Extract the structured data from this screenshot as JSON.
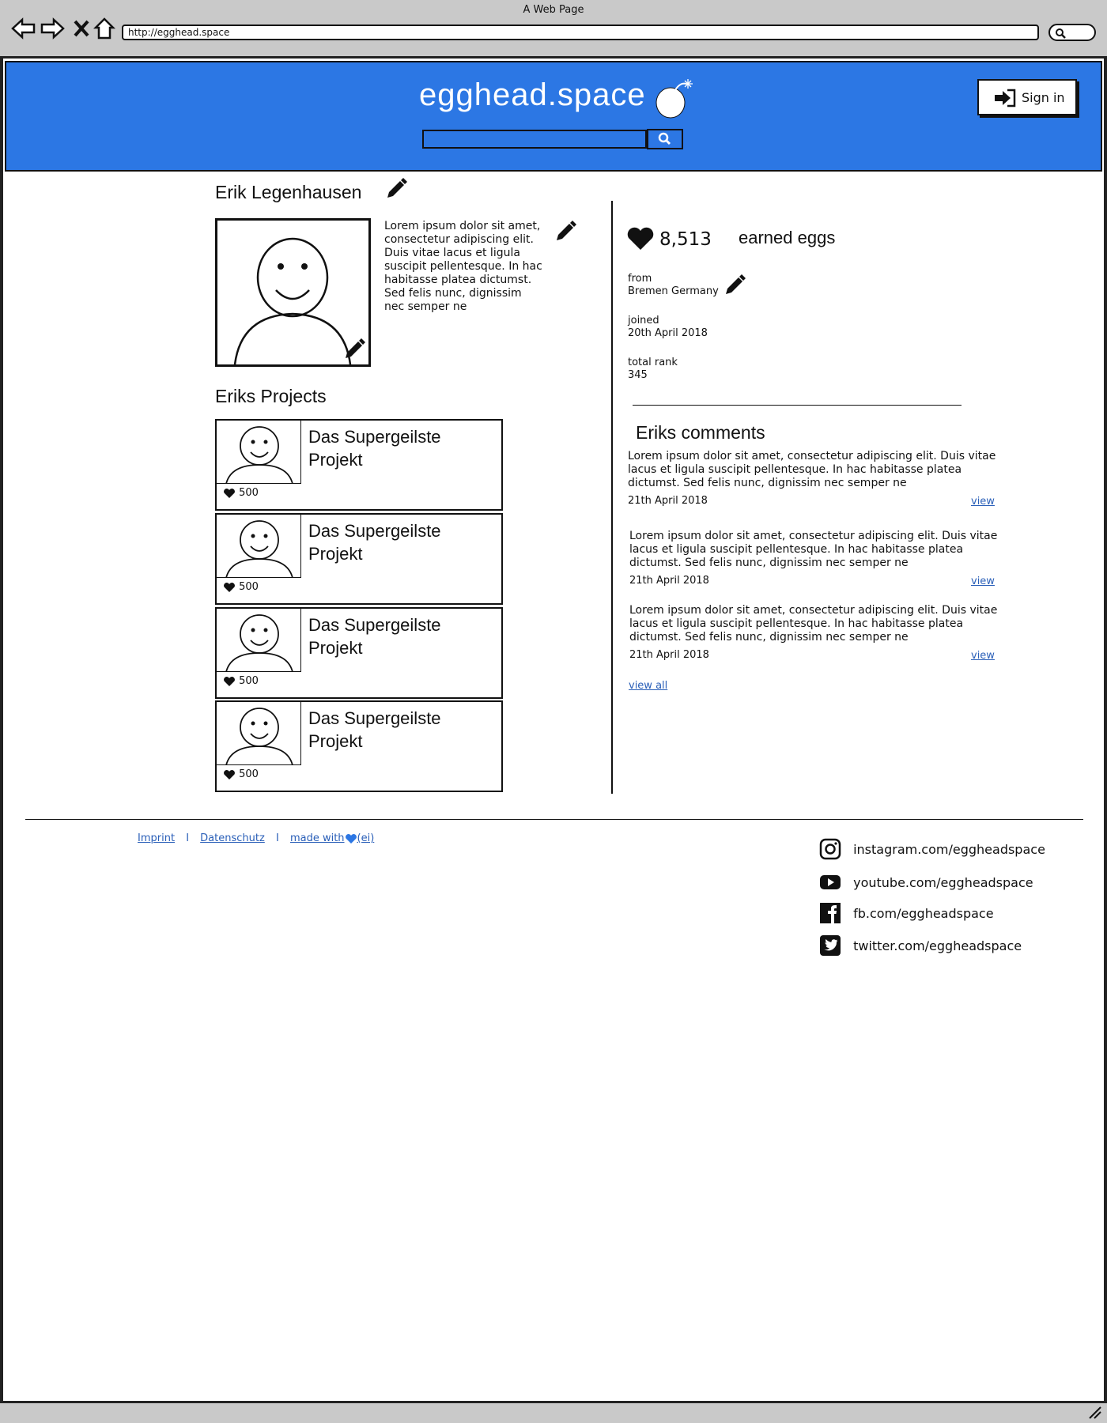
{
  "browser": {
    "window_title": "A Web Page",
    "url": "http://egghead.space"
  },
  "header": {
    "brand": "egghead.space",
    "search_placeholder": "",
    "sign_in_label": "Sign in",
    "accent_color": "#2c77e4"
  },
  "profile": {
    "name": "Erik Legenhausen",
    "bio": "Lorem ipsum dolor sit amet, consectetur adipiscing elit. Duis vitae lacus et ligula suscipit pellentesque. In hac habitasse platea dictumst. Sed felis nunc, dignissim nec semper ne",
    "eggs_count": "8,513",
    "eggs_label": "earned eggs",
    "from_label": "from",
    "from_value": "Bremen Germany",
    "joined_label": "joined",
    "joined_value": "20th April 2018",
    "rank_label": "total rank",
    "rank_value": "345"
  },
  "projects": {
    "heading": "Eriks  Projects",
    "items": [
      {
        "title": "Das Supergeilste Projekt",
        "likes": "500"
      },
      {
        "title": "Das Supergeilste Projekt",
        "likes": "500"
      },
      {
        "title": "Das Supergeilste Projekt",
        "likes": "500"
      },
      {
        "title": "Das Supergeilste Projekt",
        "likes": "500"
      }
    ]
  },
  "comments": {
    "heading": "Eriks comments",
    "items": [
      {
        "text": "Lorem ipsum dolor sit amet, consectetur adipiscing elit. Duis vitae lacus et ligula suscipit pellentesque. In hac habitasse platea dictumst. Sed felis nunc, dignissim nec semper ne",
        "date": "21th April 2018",
        "link": "view"
      },
      {
        "text": "Lorem ipsum dolor sit amet, consectetur adipiscing elit. Duis vitae lacus et ligula suscipit pellentesque. In hac habitasse platea dictumst. Sed felis nunc, dignissim nec semper ne",
        "date": "21th April 2018",
        "link": "view"
      },
      {
        "text": "Lorem ipsum dolor sit amet, consectetur adipiscing elit. Duis vitae lacus et ligula suscipit pellentesque. In hac habitasse platea dictumst. Sed felis nunc, dignissim nec semper ne",
        "date": "21th April 2018",
        "link": "view"
      }
    ],
    "view_all": "view all"
  },
  "footer": {
    "imprint": "Imprint",
    "sep": "I",
    "privacy": "Datenschutz",
    "made_with": "made with",
    "made_with_suffix": "(ei)",
    "social": [
      {
        "icon": "instagram-icon",
        "text": "instagram.com/eggheadspace"
      },
      {
        "icon": "youtube-icon",
        "text": "youtube.com/eggheadspace"
      },
      {
        "icon": "facebook-icon",
        "text": "fb.com/eggheadspace"
      },
      {
        "icon": "twitter-icon",
        "text": "twitter.com/eggheadspace"
      }
    ]
  }
}
